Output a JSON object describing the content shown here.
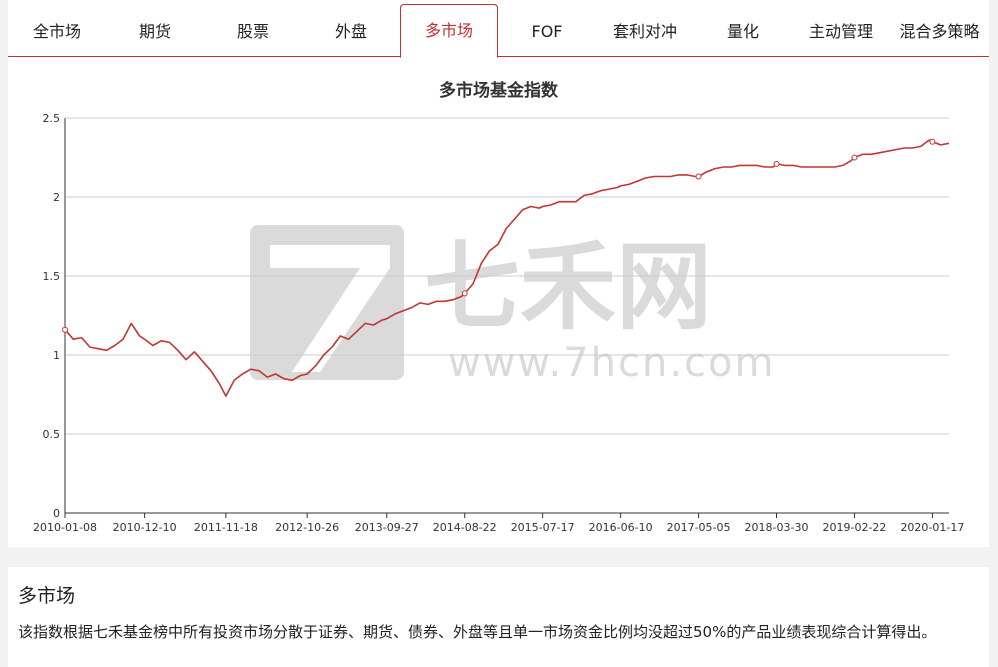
{
  "tabs": [
    {
      "label": "全市场",
      "active": false
    },
    {
      "label": "期货",
      "active": false
    },
    {
      "label": "股票",
      "active": false
    },
    {
      "label": "外盘",
      "active": false
    },
    {
      "label": "多市场",
      "active": true
    },
    {
      "label": "FOF",
      "active": false
    },
    {
      "label": "套利对冲",
      "active": false
    },
    {
      "label": "量化",
      "active": false
    },
    {
      "label": "主动管理",
      "active": false
    },
    {
      "label": "混合多策略",
      "active": false
    }
  ],
  "watermark": {
    "brand": "七禾网",
    "url": "www.7hcn.com"
  },
  "colors": {
    "accent": "#c0312f",
    "line": "#c23531",
    "grid": "#cccccc"
  },
  "chart_data": {
    "type": "line",
    "title": "多市场基金指数",
    "xlabel": "",
    "ylabel": "",
    "ylim": [
      0,
      2.5
    ],
    "yticks": [
      0,
      0.5,
      1,
      1.5,
      2,
      2.5
    ],
    "ytick_labels": [
      "0",
      "0.5",
      "1",
      "1.5",
      "2",
      "2.5"
    ],
    "xtick_labels": [
      "2010-01-08",
      "2010-12-10",
      "2011-11-18",
      "2012-10-26",
      "2013-09-27",
      "2014-08-22",
      "2015-07-17",
      "2016-06-10",
      "2017-05-05",
      "2018-03-30",
      "2019-02-22",
      "2020-01-17"
    ],
    "grid": true,
    "legend": "none",
    "series": [
      {
        "x": [
          "2010-01-08",
          "2010-02-12",
          "2010-03-19",
          "2010-04-23",
          "2010-05-28",
          "2010-07-02",
          "2010-08-06",
          "2010-09-10",
          "2010-10-15",
          "2010-11-19",
          "2010-12-10",
          "2011-01-14",
          "2011-02-18",
          "2011-03-25",
          "2011-04-29",
          "2011-06-03",
          "2011-07-08",
          "2011-08-12",
          "2011-09-16",
          "2011-10-21",
          "2011-11-18",
          "2011-12-23",
          "2012-01-27",
          "2012-03-02",
          "2012-04-06",
          "2012-05-11",
          "2012-06-15",
          "2012-07-20",
          "2012-08-24",
          "2012-09-28",
          "2012-10-26",
          "2012-11-30",
          "2013-01-04",
          "2013-02-08",
          "2013-03-15",
          "2013-04-19",
          "2013-05-24",
          "2013-06-28",
          "2013-08-02",
          "2013-09-06",
          "2013-09-27",
          "2013-11-01",
          "2013-12-06",
          "2014-01-10",
          "2014-02-14",
          "2014-03-21",
          "2014-04-25",
          "2014-05-30",
          "2014-07-04",
          "2014-08-08",
          "2014-08-22",
          "2014-09-26",
          "2014-10-31",
          "2014-12-05",
          "2015-01-09",
          "2015-02-13",
          "2015-03-20",
          "2015-04-24",
          "2015-05-29",
          "2015-07-03",
          "2015-07-17",
          "2015-08-21",
          "2015-09-25",
          "2015-10-30",
          "2015-12-04",
          "2016-01-08",
          "2016-02-12",
          "2016-03-18",
          "2016-04-22",
          "2016-05-27",
          "2016-06-10",
          "2016-07-15",
          "2016-08-19",
          "2016-09-23",
          "2016-10-28",
          "2016-12-02",
          "2017-01-06",
          "2017-02-10",
          "2017-03-17",
          "2017-04-21",
          "2017-05-05",
          "2017-06-09",
          "2017-07-14",
          "2017-08-18",
          "2017-09-22",
          "2017-10-27",
          "2017-12-01",
          "2018-01-05",
          "2018-02-09",
          "2018-03-16",
          "2018-03-30",
          "2018-05-04",
          "2018-06-08",
          "2018-07-13",
          "2018-08-17",
          "2018-09-21",
          "2018-10-26",
          "2018-11-30",
          "2019-01-04",
          "2019-02-08",
          "2019-02-22",
          "2019-03-29",
          "2019-05-03",
          "2019-06-07",
          "2019-07-12",
          "2019-08-16",
          "2019-09-20",
          "2019-10-25",
          "2019-11-29",
          "2020-01-03",
          "2020-01-17",
          "2020-02-21",
          "2020-03-27"
        ],
        "values": [
          1.16,
          1.1,
          1.11,
          1.05,
          1.04,
          1.03,
          1.06,
          1.1,
          1.2,
          1.12,
          1.1,
          1.06,
          1.09,
          1.08,
          1.03,
          0.97,
          1.02,
          0.96,
          0.9,
          0.82,
          0.74,
          0.84,
          0.88,
          0.91,
          0.9,
          0.86,
          0.88,
          0.85,
          0.84,
          0.87,
          0.88,
          0.93,
          1.0,
          1.05,
          1.12,
          1.1,
          1.15,
          1.2,
          1.19,
          1.22,
          1.23,
          1.26,
          1.28,
          1.3,
          1.33,
          1.32,
          1.34,
          1.34,
          1.35,
          1.37,
          1.39,
          1.45,
          1.58,
          1.66,
          1.7,
          1.8,
          1.86,
          1.92,
          1.94,
          1.93,
          1.94,
          1.95,
          1.97,
          1.97,
          1.97,
          2.01,
          2.02,
          2.04,
          2.05,
          2.06,
          2.07,
          2.08,
          2.1,
          2.12,
          2.13,
          2.13,
          2.13,
          2.14,
          2.14,
          2.13,
          2.13,
          2.16,
          2.18,
          2.19,
          2.19,
          2.2,
          2.2,
          2.2,
          2.19,
          2.19,
          2.21,
          2.2,
          2.2,
          2.19,
          2.19,
          2.19,
          2.19,
          2.19,
          2.2,
          2.23,
          2.25,
          2.27,
          2.27,
          2.28,
          2.29,
          2.3,
          2.31,
          2.31,
          2.32,
          2.36,
          2.35,
          2.33,
          2.34
        ]
      }
    ],
    "markers": [
      "2010-01-08",
      "2014-08-22",
      "2017-05-05",
      "2018-03-30",
      "2019-02-22",
      "2020-01-17"
    ]
  },
  "info": {
    "title": "多市场",
    "description": "该指数根据七禾基金榜中所有投资市场分散于证券、期货、债券、外盘等且单一市场资金比例均没超过50%的产品业绩表现综合计算得出。"
  }
}
